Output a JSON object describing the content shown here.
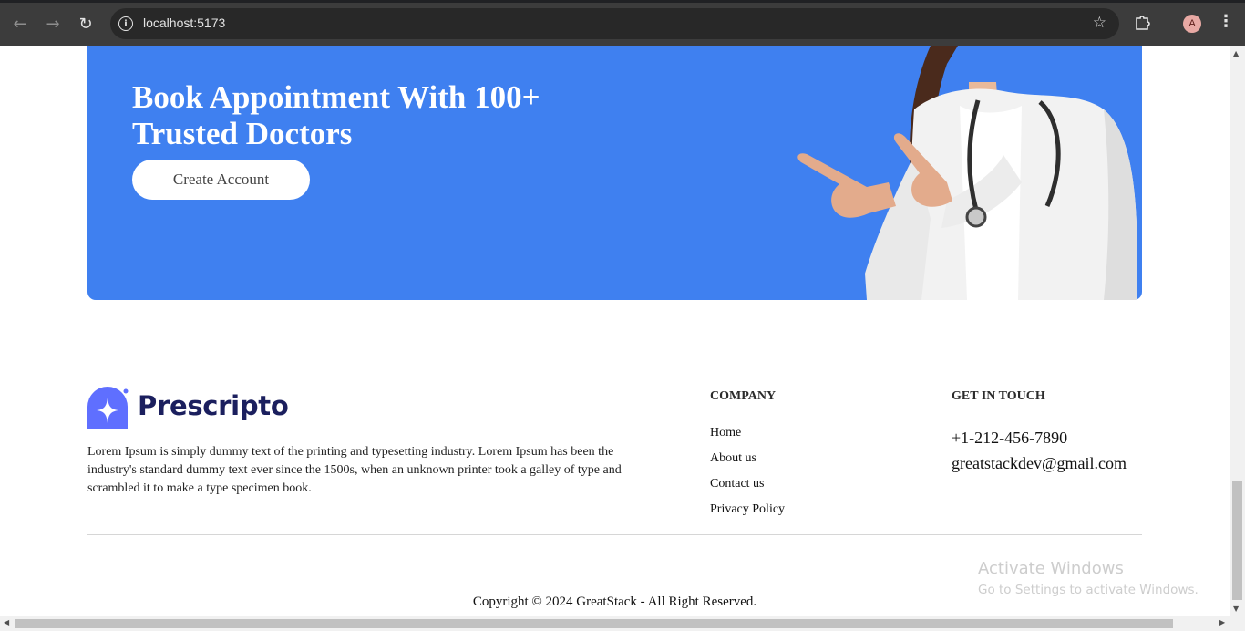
{
  "browser": {
    "url": "localhost:5173",
    "avatar_letter": "A"
  },
  "banner": {
    "title_line1": "Book Appointment With 100+",
    "title_line2": "Trusted Doctors",
    "cta_label": "Create Account",
    "background_color": "#3f80f0"
  },
  "footer": {
    "brand_name": "Prescripto",
    "brand_color": "#5f6fff",
    "about": "Lorem Ipsum is simply dummy text of the printing and typesetting industry. Lorem Ipsum has been the industry's standard dummy text ever since the 1500s, when an unknown printer took a galley of type and scrambled it to make a type specimen book.",
    "company": {
      "heading": "COMPANY",
      "links": [
        "Home",
        "About us",
        "Contact us",
        "Privacy Policy"
      ]
    },
    "contact": {
      "heading": "GET IN TOUCH",
      "phone": "+1-212-456-7890",
      "email": "greatstackdev@gmail.com"
    },
    "copyright": "Copyright © 2024 GreatStack - All Right Reserved."
  },
  "os_watermark": {
    "line1": "Activate Windows",
    "line2": "Go to Settings to activate Windows."
  },
  "icons": {
    "back": "back-arrow-icon",
    "forward": "forward-arrow-icon",
    "reload": "reload-icon",
    "site_info": "info-icon",
    "bookmark": "star-icon",
    "extensions": "puzzle-icon",
    "menu": "kebab-menu-icon"
  }
}
